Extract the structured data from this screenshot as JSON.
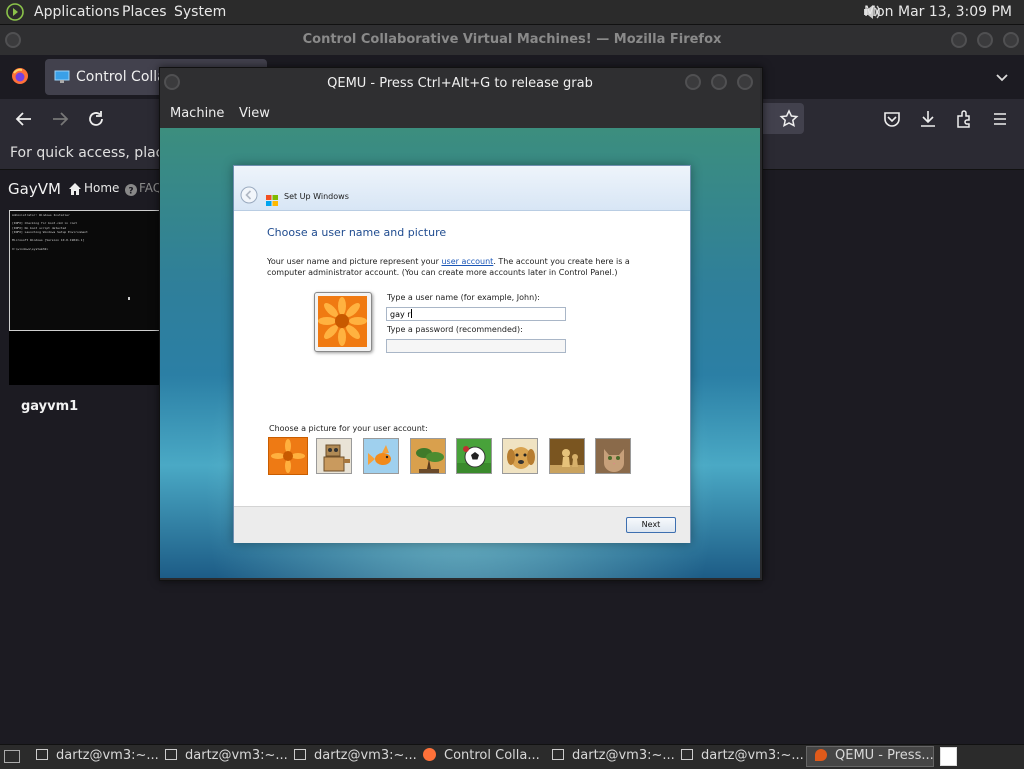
{
  "top_panel": {
    "menus": [
      "Applications",
      "Places",
      "System"
    ],
    "clock": "Mon Mar 13,  3:09 PM"
  },
  "firefox": {
    "window_title": "Control Collaborative Virtual Machines! — Mozilla Firefox",
    "tab_title": "Control Collab",
    "bookmarks_hint": "For quick access, place yo",
    "site": {
      "brand": "GayVM",
      "nav_home": "Home",
      "nav_faq": "FAQ",
      "vm_name": "gayvm1",
      "thumbnail_lines": [
        "Administrator: Windows Installer",
        "",
        "[INFO] Checking for boot.cmd in root",
        "[INFO] No boot script detected",
        "[INFO] Launching Windows Setup Environment",
        "",
        "Microsoft Windows [Version 10.0.19041.1]",
        "",
        "X:\\windows\\system32>"
      ]
    }
  },
  "qemu": {
    "title": "QEMU - Press Ctrl+Alt+G to release grab",
    "menu": [
      "Machine",
      "View"
    ]
  },
  "setup": {
    "window_title": "Set Up Windows",
    "heading": "Choose a user name and picture",
    "desc_part1": "Your user name and picture represent your ",
    "desc_link": "user account",
    "desc_part2": ". The account you create here is a computer administrator account. (You can create more accounts later in Control Panel.)",
    "username_label": "Type a user name (for example, John):",
    "username_value": "gay r",
    "password_label": "Type a password (recommended):",
    "password_value": "",
    "pictures_label": "Choose a picture for your user account:",
    "pictures": [
      "flower",
      "robot",
      "goldfish",
      "bonsai",
      "soccer-ball",
      "dog",
      "chess",
      "kitten"
    ],
    "selected_picture": 0,
    "next_button": "Next"
  },
  "taskbar": {
    "items": [
      "dartz@vm3:~...",
      "dartz@vm3:~...",
      "dartz@vm3:~...",
      "Control Colla...",
      "dartz@vm3:~...",
      "dartz@vm3:~...",
      "QEMU - Press..."
    ]
  },
  "colors": {
    "link": "#1a56b7",
    "heading": "#1f4b8f",
    "firefox_bg": "#1c1b22"
  }
}
